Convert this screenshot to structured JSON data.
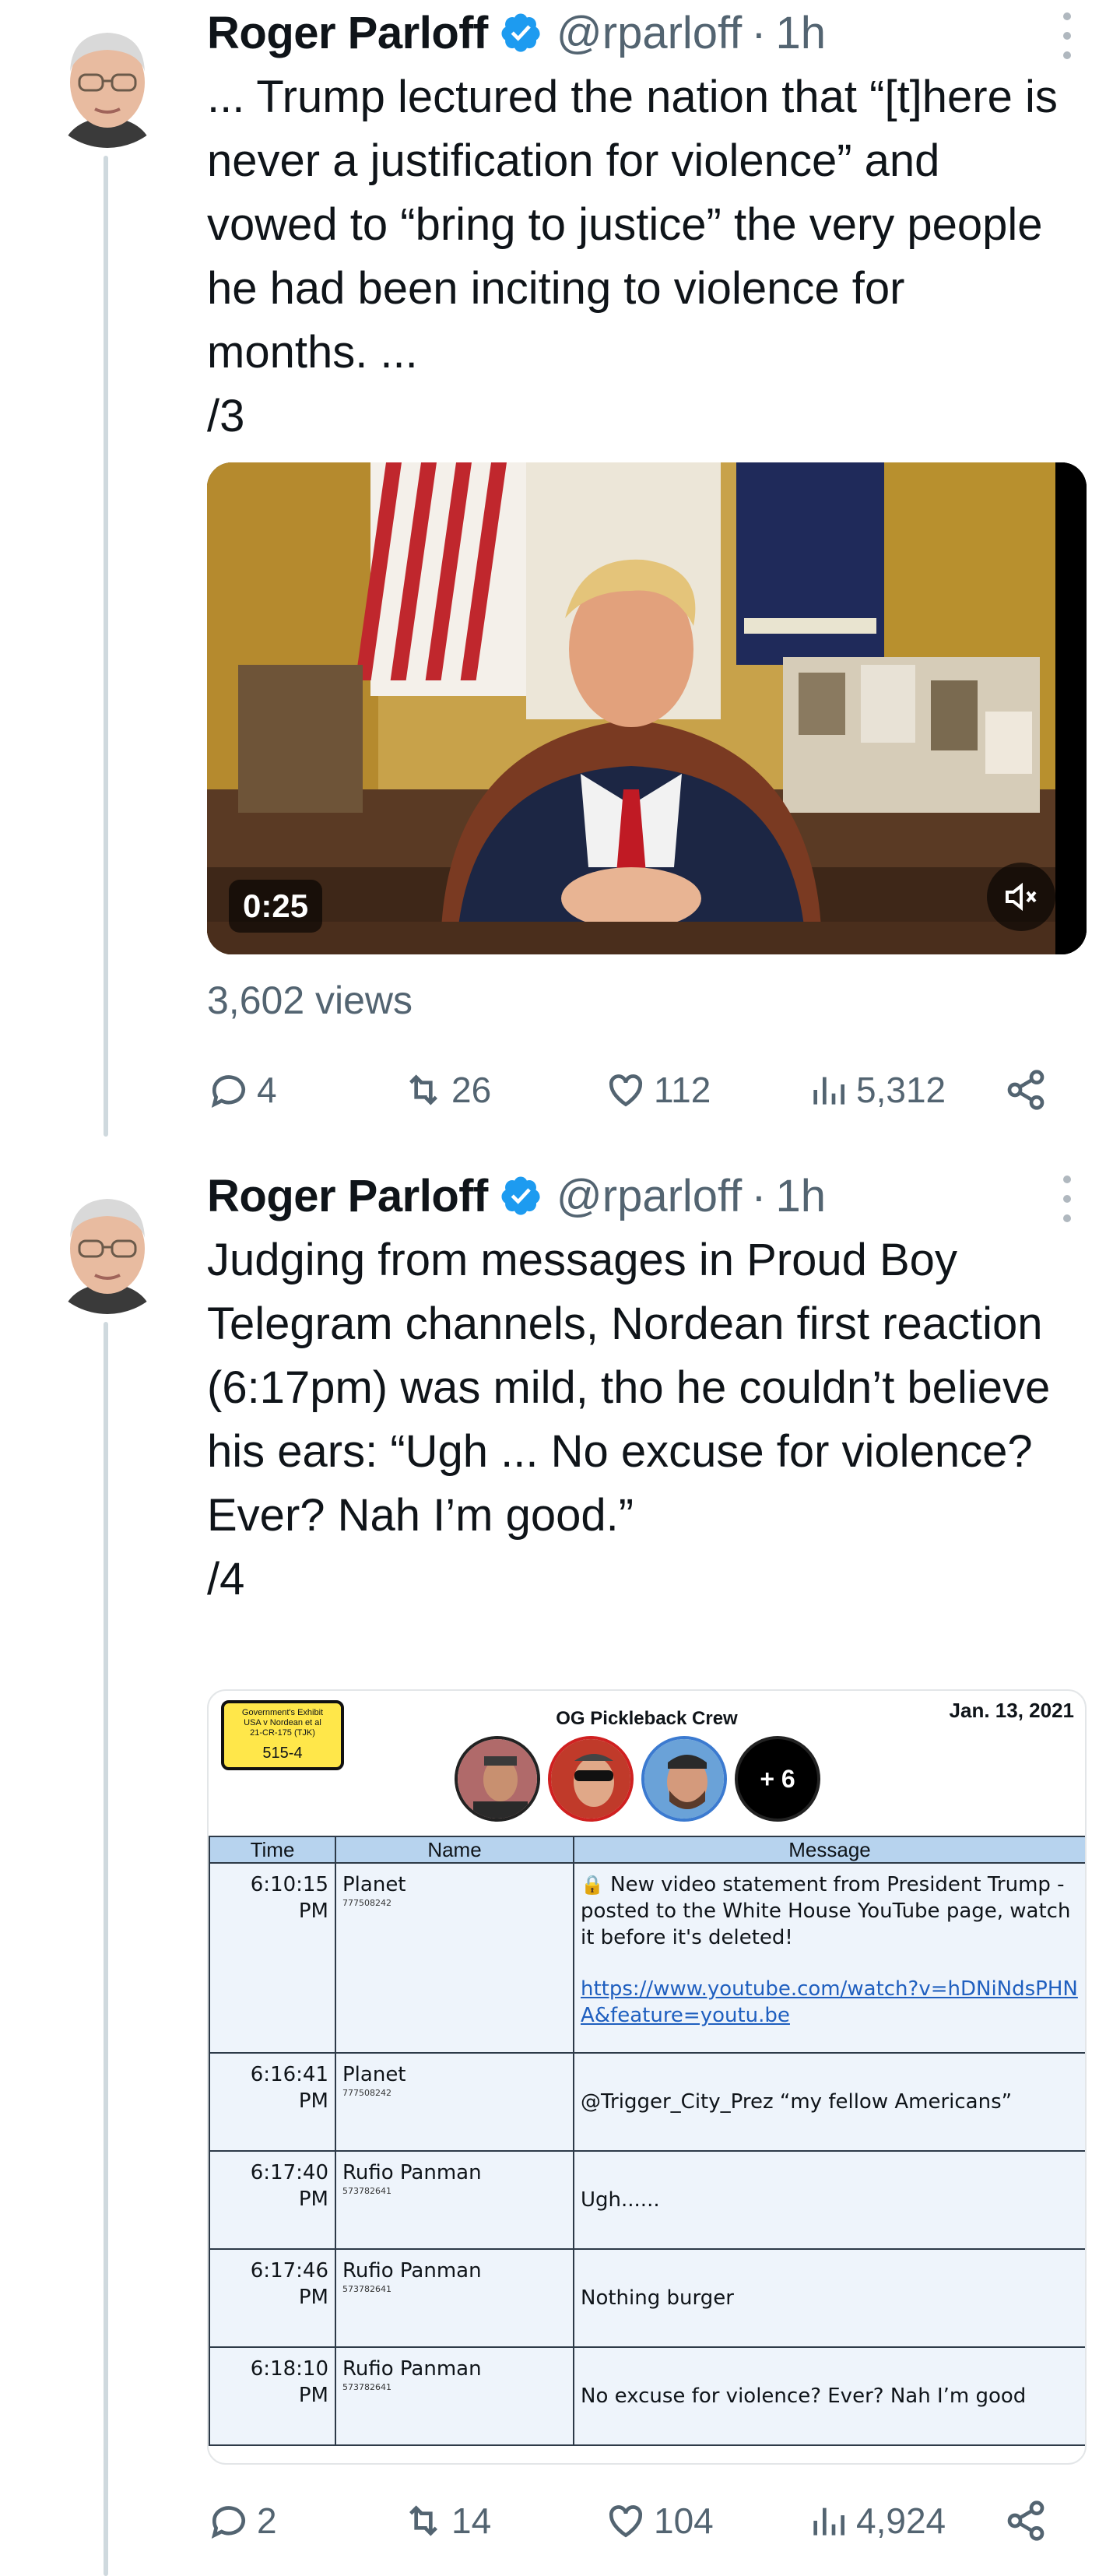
{
  "tweets": [
    {
      "author_name": "Roger Parloff",
      "handle": "@rparloff",
      "time": "1h",
      "text": "... Trump lectured the nation that “[t]here is never a justification for violence” and vowed to “bring to justice” the very people he had been inciting to violence for months. ...\n/3",
      "video_duration": "0:25",
      "views": "3,602 views",
      "replies": "4",
      "reposts": "26",
      "likes": "112",
      "analytics": "5,312"
    },
    {
      "author_name": "Roger Parloff",
      "handle": "@rparloff",
      "time": "1h",
      "text": "Judging from messages in Proud Boy Telegram channels, Nordean first reaction (6:17pm) was mild, tho he couldn’t believe his ears: “Ugh ... No excuse for violence? Ever? Nah I’m good.”\n/4",
      "replies": "2",
      "reposts": "14",
      "likes": "104",
      "analytics": "4,924"
    }
  ],
  "exhibit": {
    "badge_line1": "Government's Exhibit",
    "badge_line2": "USA v Nordean et al",
    "badge_line3": "21-CR-175 (TJK)",
    "badge_number": "515-4",
    "title": "OG Pickleback Crew",
    "date": "Jan. 13, 2021",
    "more_members": "+ 6",
    "columns": [
      "Time",
      "Name",
      "Message"
    ],
    "rows": [
      {
        "time": "6:10:15",
        "ampm": "PM",
        "name": "Planet",
        "id": "777508242",
        "message": "New video statement from President Trump - posted to the White House YouTube page, watch it before it's deleted!",
        "link": "https://www.youtube.com/watch?v=hDNiNdsPHNA&feature=youtu.be"
      },
      {
        "time": "6:16:41",
        "ampm": "PM",
        "name": "Planet",
        "id": "777508242",
        "message": "@Trigger_City_Prez “my fellow Americans”"
      },
      {
        "time": "6:17:40",
        "ampm": "PM",
        "name": "Rufio Panman",
        "id": "573782641",
        "message": "Ugh......"
      },
      {
        "time": "6:17:46",
        "ampm": "PM",
        "name": "Rufio Panman",
        "id": "573782641",
        "message": "Nothing burger"
      },
      {
        "time": "6:18:10",
        "ampm": "PM",
        "name": "Rufio Panman",
        "id": "573782641",
        "message": "No excuse for violence?  Ever?  Nah I’m good"
      }
    ]
  },
  "colors": {
    "verified": "#1d9bf0",
    "secondary_text": "#536471",
    "thread_line": "#cfd9de",
    "table_header": "#b7d3ee"
  },
  "icons": [
    "reply-icon",
    "repost-icon",
    "like-icon",
    "analytics-icon",
    "share-icon",
    "verified-badge-icon",
    "mute-icon",
    "more-options-icon"
  ]
}
